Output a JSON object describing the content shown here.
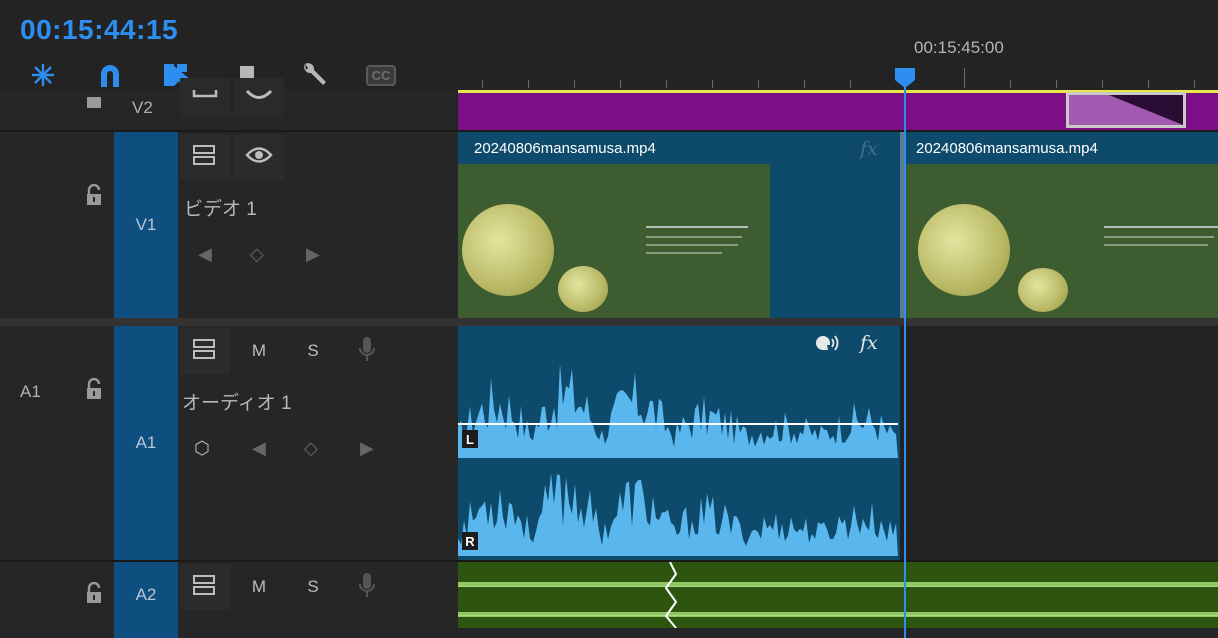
{
  "timecode": "00:15:44:15",
  "ruler": {
    "time_label": "00:15:45:00"
  },
  "toolbar": {
    "icons": [
      "snap-icon",
      "magnet-icon",
      "linked-selection-icon",
      "marker-icon",
      "wrench-icon",
      "captions-icon"
    ],
    "captions_label": "CC"
  },
  "tracks": {
    "v2": {
      "target": "V2"
    },
    "v1": {
      "target": "V1",
      "name": "ビデオ 1"
    },
    "a1": {
      "source": "A1",
      "target": "A1",
      "name": "オーディオ 1",
      "mute": "M",
      "solo": "S"
    },
    "a2": {
      "target": "A2",
      "mute": "M",
      "solo": "S"
    }
  },
  "clips": {
    "v1_left": {
      "name": "20240806mansamusa.mp4",
      "fx": "fx"
    },
    "v1_right": {
      "name": "20240806mansamusa.mp4"
    },
    "a1": {
      "fx": "fx",
      "left_channel": "L",
      "right_channel": "R"
    }
  },
  "colors": {
    "accent": "#2e8ef0",
    "video_clip": "#0d4a6b",
    "v2_clip": "#7a0f86",
    "audio_wave": "#5ab7ee",
    "a2_clip": "#2d5510",
    "a2_wave": "#8fc765"
  }
}
